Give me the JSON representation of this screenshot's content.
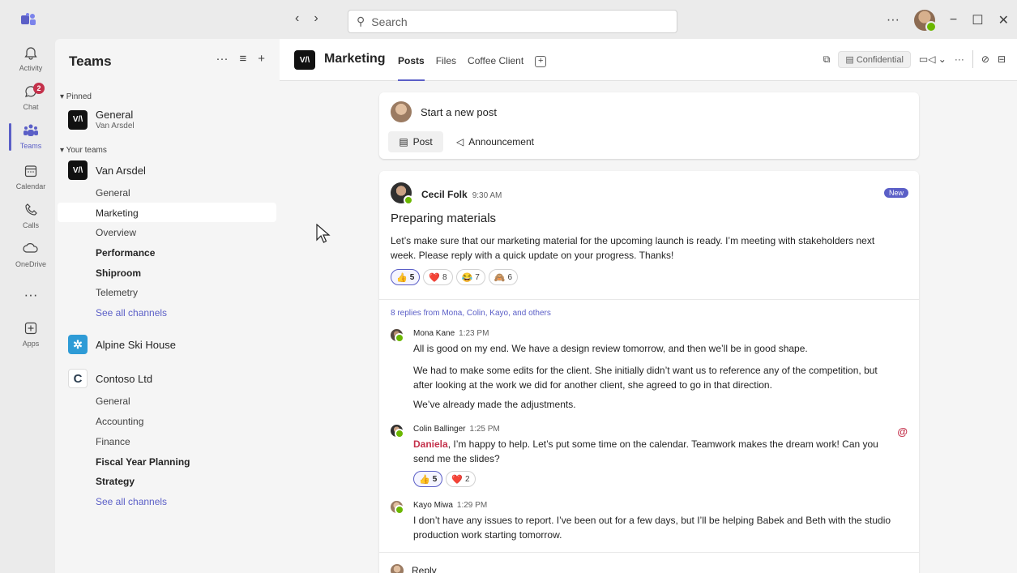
{
  "titlebar": {
    "search_placeholder": "Search",
    "more": "···",
    "nav_back": "‹",
    "nav_forward": "›",
    "minimize": "−",
    "maximize": "☐",
    "close": "✕"
  },
  "rail": {
    "items": [
      {
        "label": "Activity",
        "icon": "bell-icon",
        "glyph": "🔔"
      },
      {
        "label": "Chat",
        "icon": "chat-icon",
        "glyph": "💬",
        "badge": "2"
      },
      {
        "label": "Teams",
        "icon": "teams-icon",
        "glyph": "👥"
      },
      {
        "label": "Calendar",
        "icon": "calendar-icon",
        "glyph": "📅"
      },
      {
        "label": "Calls",
        "icon": "phone-icon",
        "glyph": "📞"
      },
      {
        "label": "OneDrive",
        "icon": "cloud-icon",
        "glyph": "☁"
      },
      {
        "label": "",
        "icon": "more-icon",
        "glyph": "···"
      },
      {
        "label": "Apps",
        "icon": "apps-icon",
        "glyph": "⊞"
      }
    ]
  },
  "panel": {
    "title": "Teams",
    "tools": [
      "···",
      "≡",
      "+"
    ],
    "pinned_label": "▾ Pinned",
    "pinned_team": {
      "name": "General",
      "sub": "Van Arsdel",
      "logo": "V/\\"
    },
    "your_teams_label": "▾ Your teams",
    "team1": {
      "name": "Van Arsdel",
      "logo": "V/\\",
      "channels": [
        "General",
        "Marketing",
        "Overview",
        "Performance",
        "Shiproom",
        "Telemetry"
      ],
      "see_all": "See all channels"
    },
    "team2": {
      "name": "Alpine Ski House",
      "logo": "✲"
    },
    "team3": {
      "name": "Contoso Ltd",
      "logo": "C",
      "channels": [
        "General",
        "Accounting",
        "Finance",
        "Fiscal Year Planning",
        "Strategy"
      ],
      "see_all": "See all channels"
    }
  },
  "channel": {
    "logo": "V/\\",
    "title": "Marketing",
    "tabs": [
      "Posts",
      "Files",
      "Coffee Client"
    ],
    "tab_add": "+",
    "confidential": "Confidential",
    "more": "···"
  },
  "compose": {
    "prompt": "Start a new post",
    "post_label": "Post",
    "announcement_label": "Announcement"
  },
  "post": {
    "author": "Cecil Folk",
    "time": "9:30 AM",
    "badge": "New",
    "title": "Preparing materials",
    "body": "Let’s make sure that our marketing material for the upcoming launch is ready. I’m meeting with stakeholders next week. Please reply with a quick update on your progress. Thanks!",
    "reactions": [
      {
        "emoji": "👍",
        "count": "5"
      },
      {
        "emoji": "❤️",
        "count": "8"
      },
      {
        "emoji": "😂",
        "count": "7"
      },
      {
        "emoji": "🙈",
        "count": "6"
      }
    ],
    "replies_link": "8 replies from Mona, Colin, Kayo, and others",
    "replies": [
      {
        "author": "Mona Kane",
        "time": "1:23 PM",
        "lines": [
          "All is good on my end. We have a design review tomorrow, and then we’ll be in good shape.",
          "We had to make some edits for the client. She initially didn’t want us to reference any of the competition, but after looking at the work we did for another client, she agreed to go in that direction.",
          "We’ve already made the adjustments."
        ]
      },
      {
        "author": "Colin Ballinger",
        "time": "1:25 PM",
        "mention": "Daniela",
        "text": ", I’m happy to help. Let’s put some time on the calendar. Teamwork makes the dream work! Can you send me the slides?",
        "reactions": [
          {
            "emoji": "👍",
            "count": "5"
          },
          {
            "emoji": "❤️",
            "count": "2"
          }
        ],
        "at": "@"
      },
      {
        "author": "Kayo Miwa",
        "time": "1:29 PM",
        "text": "I don’t have any issues to report. I’ve been out for a few days, but I’ll be helping Babek and Beth with the studio production work starting tomorrow."
      }
    ],
    "reply_label": "Reply"
  },
  "colors": {
    "accent": "#5b5fc7",
    "presence": "#6bb700",
    "mention": "#c4314b"
  }
}
